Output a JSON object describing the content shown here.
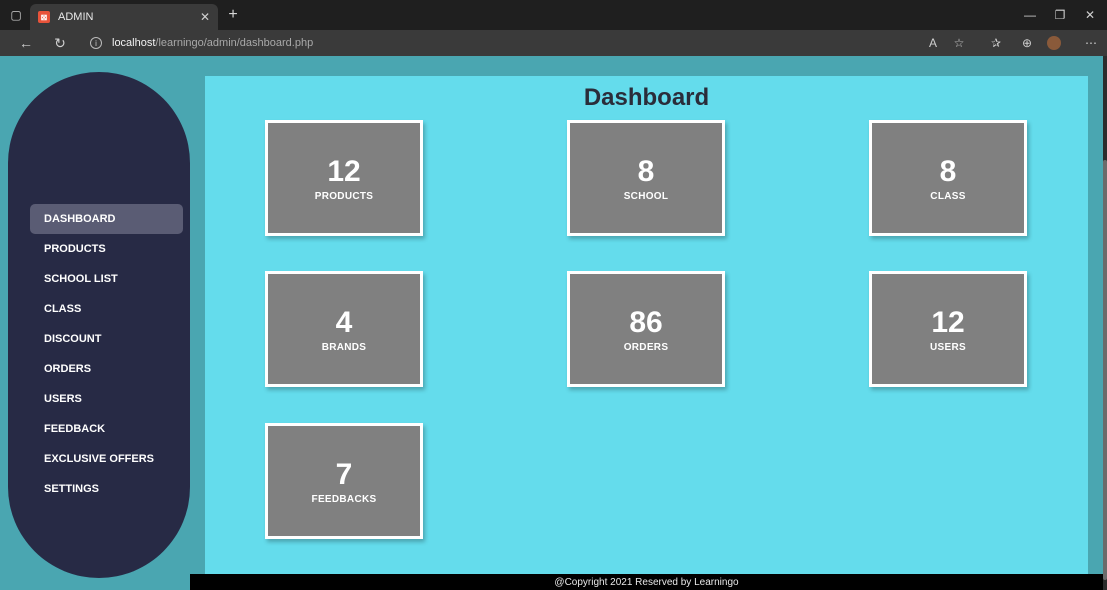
{
  "browser": {
    "tab_title": "ADMIN",
    "tab_favicon": "xampp-icon",
    "url_host": "localhost",
    "url_path": "/learningo/admin/dashboard.php"
  },
  "sidebar": {
    "items": [
      {
        "label": "DASHBOARD",
        "active": true
      },
      {
        "label": "PRODUCTS"
      },
      {
        "label": "SCHOOL LIST"
      },
      {
        "label": "CLASS"
      },
      {
        "label": "DISCOUNT"
      },
      {
        "label": "ORDERS"
      },
      {
        "label": "USERS"
      },
      {
        "label": "FEEDBACK"
      },
      {
        "label": "EXCLUSIVE OFFERS"
      },
      {
        "label": "SETTINGS"
      }
    ]
  },
  "main": {
    "title": "Dashboard",
    "cards": [
      {
        "value": "12",
        "label": "PRODUCTS"
      },
      {
        "value": "8",
        "label": "SCHOOL"
      },
      {
        "value": "8",
        "label": "CLASS"
      },
      {
        "value": "4",
        "label": "BRANDS"
      },
      {
        "value": "86",
        "label": "ORDERS"
      },
      {
        "value": "12",
        "label": "USERS"
      },
      {
        "value": "7",
        "label": "FEEDBACKS"
      }
    ]
  },
  "footer": {
    "text": "@Copyright 2021 Reserved by Learningo"
  },
  "colors": {
    "sidebar_bg": "#272a45",
    "main_bg": "#64dcec",
    "page_bg": "#4aa6b1",
    "card_bg": "#808080",
    "footer_bg": "#000000"
  }
}
